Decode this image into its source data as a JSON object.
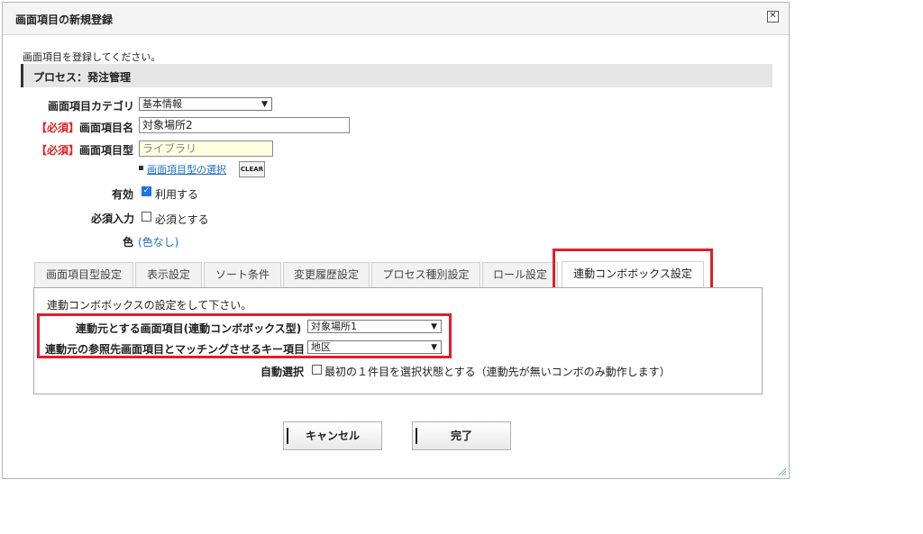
{
  "dialog": {
    "title": "画面項目の新規登録",
    "close_icon": "close-icon",
    "intro": "画面項目を登録してください。",
    "process": "プロセス：発注管理"
  },
  "form": {
    "category_label": "画面項目カテゴリ",
    "category_value": "基本情報",
    "required_mark": "【必須】",
    "name_label": "画面項目名",
    "name_value": "対象場所2",
    "type_label": "画面項目型",
    "type_value": "ライブラリ",
    "type_select_link": "画面項目型の選択",
    "clear_label": "CLEAR",
    "enabled_label": "有効",
    "enabled_text": "利用する",
    "enabled_checked": true,
    "required_input_label": "必須入力",
    "required_input_text": "必須とする",
    "required_input_checked": false,
    "color_label": "色",
    "color_value": "(色なし)"
  },
  "tabs": [
    {
      "label": "画面項目型設定"
    },
    {
      "label": "表示設定"
    },
    {
      "label": "ソート条件"
    },
    {
      "label": "変更履歴設定"
    },
    {
      "label": "プロセス種別設定"
    },
    {
      "label": "ロール設定"
    },
    {
      "label": "連動コンボボックス設定",
      "active": true
    }
  ],
  "panel": {
    "description": "連動コンボボックスの設定をして下さい。",
    "source_label": "連動元とする画面項目(連動コンボボックス型)",
    "source_value": "対象場所1",
    "key_label": "連動元の参照先画面項目とマッチングさせるキー項目",
    "key_value": "地区",
    "auto_select_label": "自動選択",
    "auto_select_text": "最初の１件目を選択状態とする（連動先が無いコンボのみ動作します）",
    "auto_select_checked": false
  },
  "buttons": {
    "cancel": "キャンセル",
    "done": "完了"
  },
  "colors": {
    "highlight": "#e21d2c",
    "required": "#dd2222",
    "link": "#1a6fc9"
  }
}
